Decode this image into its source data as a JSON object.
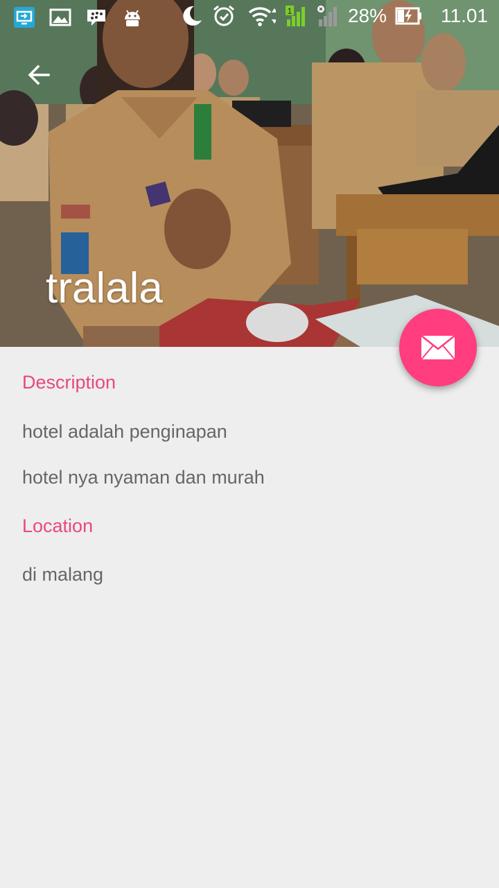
{
  "status_bar": {
    "battery_percent": "28%",
    "time": "11.01",
    "icons_left": [
      "screen-mirror-icon",
      "gallery-icon",
      "bbm-icon",
      "android-icon"
    ],
    "icons_right": [
      "moon-icon",
      "alarm-icon",
      "wifi-icon",
      "signal-sim1-icon",
      "signal-sim2-icon",
      "battery-charging-icon"
    ]
  },
  "header": {
    "title": "tralala",
    "back_icon": "arrow-back-icon"
  },
  "fab": {
    "icon": "mail-icon",
    "color": "#ff3d7f"
  },
  "details": {
    "description_title": "Description",
    "description_line1": "hotel adalah penginapan",
    "description_line2": "hotel nya nyaman dan murah",
    "location_title": "Location",
    "location_line1": "di malang"
  },
  "colors": {
    "accent": "#e8487d",
    "background": "#eeeeee",
    "body_text": "#666666"
  }
}
